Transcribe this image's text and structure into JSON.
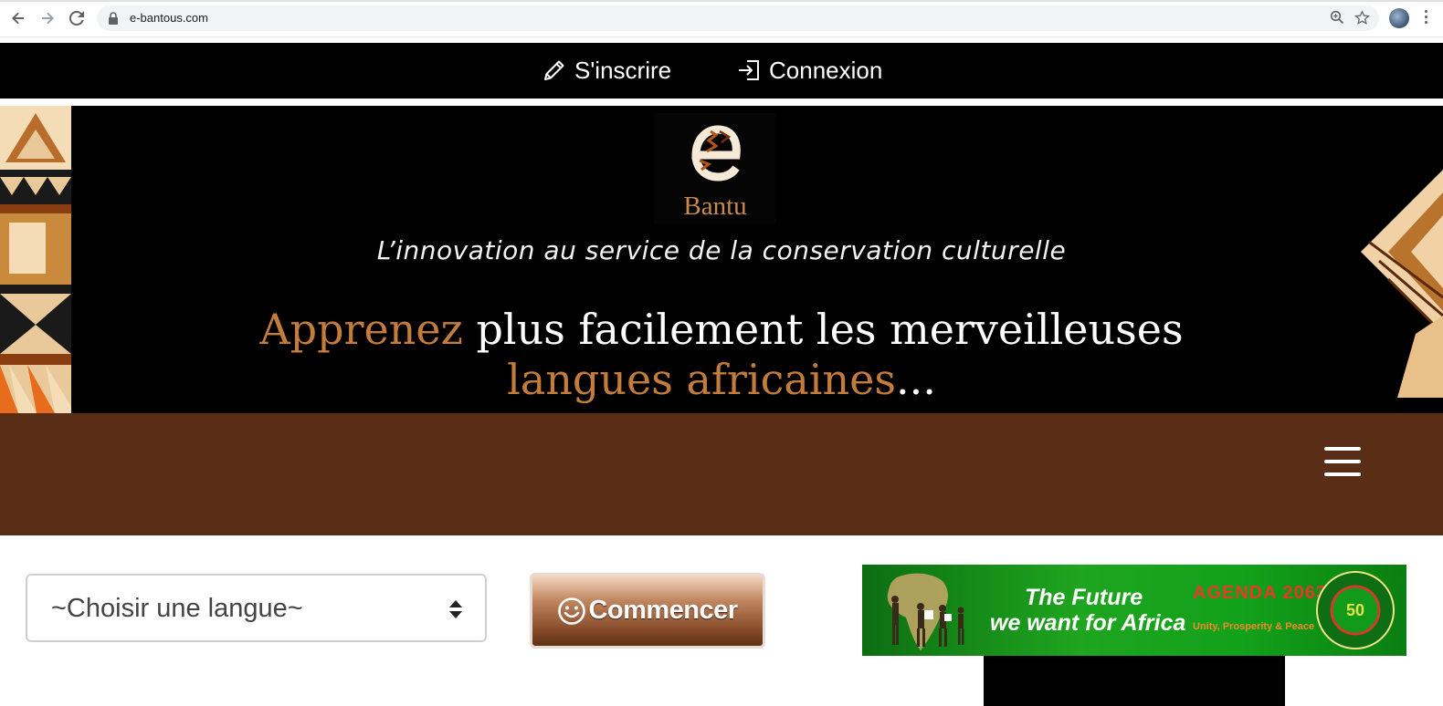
{
  "browser": {
    "url": "e-bantous.com",
    "icons": [
      "back-icon",
      "forward-icon",
      "reload-icon",
      "lock-icon",
      "zoom-icon",
      "star-icon",
      "profile-avatar",
      "menu-kebab-icon"
    ]
  },
  "auth": {
    "register_label": "S'inscrire",
    "login_label": "Connexion"
  },
  "hero": {
    "logo_text": "Bantu",
    "tagline": "L’innovation au service de la conservation culturelle",
    "headline_accent1": "Apprenez",
    "headline_mid": " plus facilement les merveilleuses",
    "headline_accent2": "langues africaines",
    "headline_end": "..."
  },
  "controls": {
    "language_select_value": "~Choisir une langue~",
    "start_button_label": "Commencer"
  },
  "banner": {
    "line1": "The Future",
    "line2": "we want for Africa",
    "agenda": "AGENDA 2063",
    "agenda_sub": "Unity, Prosperity & Peace",
    "seal_text": "50"
  },
  "colors": {
    "accent_brown": "#5a2d17",
    "accent_orange": "#c47c3a",
    "banner_green": "#1fa51f"
  }
}
